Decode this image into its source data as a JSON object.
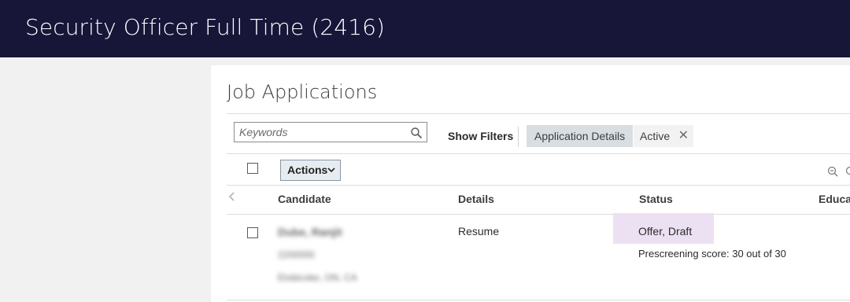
{
  "header": {
    "title": "Security Officer Full Time (2416)"
  },
  "page": {
    "title": "Job Applications"
  },
  "search": {
    "placeholder": "Keywords",
    "value": ""
  },
  "toolbar": {
    "show_filters_label": "Show Filters",
    "chips": {
      "application_details": "Application Details",
      "active": "Active"
    },
    "actions_label": "Actions"
  },
  "table": {
    "columns": {
      "candidate": "Candidate",
      "details": "Details",
      "status": "Status",
      "education": "Educa"
    },
    "rows": [
      {
        "candidate_name": "Dube, Ranjit",
        "candidate_id": "2200000",
        "candidate_location": "Etobicoke, ON, CA",
        "details": "Resume",
        "status": "Offer, Draft",
        "prescreening": "Prescreening score: 30 out of 30"
      }
    ]
  },
  "colors": {
    "header_bg": "#171538",
    "status_highlight": "#ece1f2",
    "chip_bg": "#d9dee3",
    "side_bg": "#f1f1f1"
  }
}
